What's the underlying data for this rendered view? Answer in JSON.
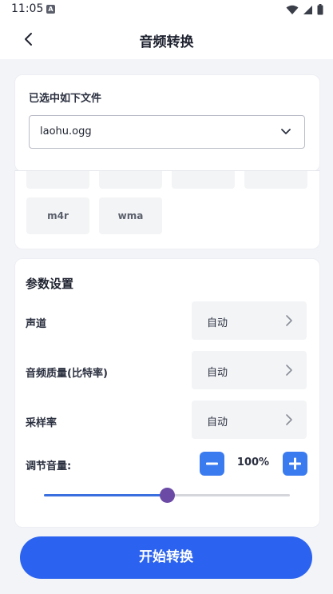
{
  "status_bar": {
    "time": "11:05",
    "badge": "A"
  },
  "header": {
    "title": "音频转换"
  },
  "file_section": {
    "label": "已选中如下文件",
    "selected_file": "laohu.ogg"
  },
  "formats": {
    "visible": [
      "m4r",
      "wma"
    ]
  },
  "params": {
    "title": "参数设置",
    "items": [
      {
        "label": "声道",
        "value": "自动"
      },
      {
        "label": "音频质量(比特率)",
        "value": "自动"
      },
      {
        "label": "采样率",
        "value": "自动"
      }
    ],
    "volume": {
      "label": "调节音量:",
      "value_text": "100%",
      "slider_fraction": 0.5
    }
  },
  "actions": {
    "start_label": "开始转换"
  },
  "colors": {
    "accent": "#2b63f0",
    "button": "#3a7bf0",
    "thumb": "#6b4aa6"
  }
}
